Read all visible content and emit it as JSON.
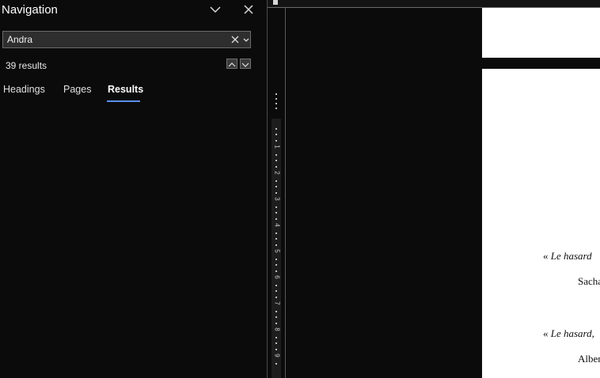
{
  "navigation": {
    "title": "Navigation",
    "search": {
      "value": "Andra",
      "placeholder": ""
    },
    "result_count": "39 results",
    "tabs": [
      {
        "label": "Headings",
        "active": false
      },
      {
        "label": "Pages",
        "active": false
      },
      {
        "label": "Results",
        "active": true
      }
    ],
    "icons": {
      "options": "chevron-down-icon",
      "close": "close-icon",
      "clear": "clear-icon",
      "dropdown": "caret-down-icon",
      "prev": "arrow-up-icon",
      "next": "arrow-down-icon"
    }
  },
  "ruler": {
    "numbers": [
      "1",
      "2",
      "3",
      "4",
      "5",
      "6",
      "7",
      "8",
      "9"
    ]
  },
  "document": {
    "quote1_mark": "«",
    "quote1": "Le hasard",
    "author1": "Sacha",
    "quote2_mark": "«",
    "quote2": "Le hasard,",
    "author2": "Alber"
  },
  "colors": {
    "background": "#0c0b0b",
    "accent": "#5b8fe6",
    "page": "#ffffff"
  }
}
